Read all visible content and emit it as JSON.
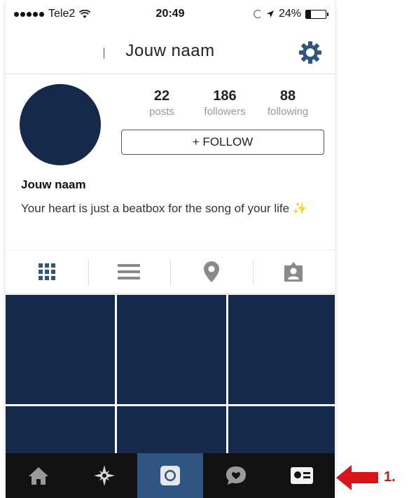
{
  "status_bar": {
    "carrier": "Tele2",
    "time": "20:49",
    "battery": "24%",
    "battery_level": 0.24
  },
  "nav": {
    "title": "Jouw naam",
    "settings_icon": "gear-icon"
  },
  "profile": {
    "stats": [
      {
        "count": "22",
        "label": "posts"
      },
      {
        "count": "186",
        "label": "followers"
      },
      {
        "count": "88",
        "label": "following"
      }
    ],
    "follow_label": "+ FOLLOW",
    "name": "Jouw naam",
    "bio": "Your heart is just a beatbox for the song of your life",
    "bio_emoji": "✨"
  },
  "view_tabs": [
    "grid-view-icon",
    "list-view-icon",
    "location-pin-icon",
    "tagged-person-icon"
  ],
  "tab_bar": [
    "home-icon",
    "explore-icon",
    "camera-icon",
    "activity-icon",
    "profile-icon"
  ],
  "annotation": {
    "step": "1."
  },
  "colors": {
    "accent": "#2e5584",
    "tile": "#15294a",
    "arrow": "#d9141b"
  }
}
